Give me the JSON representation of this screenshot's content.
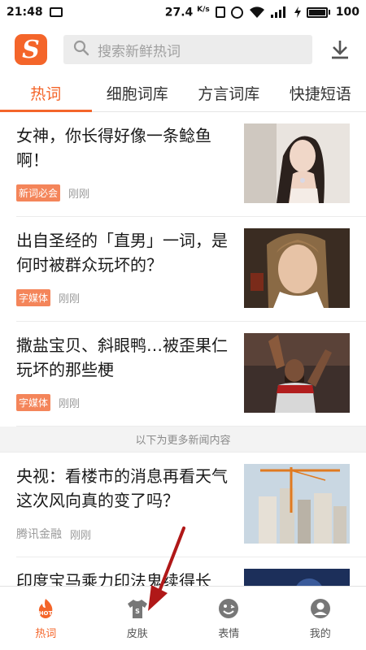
{
  "status": {
    "time": "21:48",
    "speed": "27.4",
    "speed_unit": "K/s",
    "battery": "100"
  },
  "header": {
    "logo_letter": "S",
    "search_placeholder": "搜索新鲜热词"
  },
  "tabs": [
    {
      "label": "热词",
      "active": true
    },
    {
      "label": "细胞词库",
      "active": false
    },
    {
      "label": "方言词库",
      "active": false
    },
    {
      "label": "快捷短语",
      "active": false
    }
  ],
  "news": [
    {
      "title": "女神，你长得好像一条鲶鱼啊！",
      "tag": "新词必会",
      "time": "刚刚",
      "image": "woman-portrait"
    },
    {
      "title": "出自圣经的「直男」一词，是何时被群众玩坏的？",
      "tag": "字媒体",
      "time": "刚刚",
      "image": "man-portrait"
    },
    {
      "title": "撒盐宝贝、斜眼鸭…被歪果仁玩坏的那些梗",
      "tag": "字媒体",
      "time": "刚刚",
      "image": "basketball-player"
    }
  ],
  "more_divider": "以下为更多新闻内容",
  "more_news": [
    {
      "title": "央视：看楼市的消息再看天气 这次风向真的变了吗？",
      "source": "腾讯金融",
      "time": "刚刚",
      "image": "crane-buildings"
    }
  ],
  "partial_title": "印度宝马乘力印法鬼续得长",
  "bottom_nav": [
    {
      "label": "热词",
      "icon": "hot-icon",
      "active": true
    },
    {
      "label": "皮肤",
      "icon": "tshirt-icon",
      "active": false
    },
    {
      "label": "表情",
      "icon": "emoji-icon",
      "active": false
    },
    {
      "label": "我的",
      "icon": "profile-icon",
      "active": false
    }
  ],
  "colors": {
    "accent": "#f4652a",
    "tag": "#f4855a",
    "arrow": "#b01818"
  }
}
